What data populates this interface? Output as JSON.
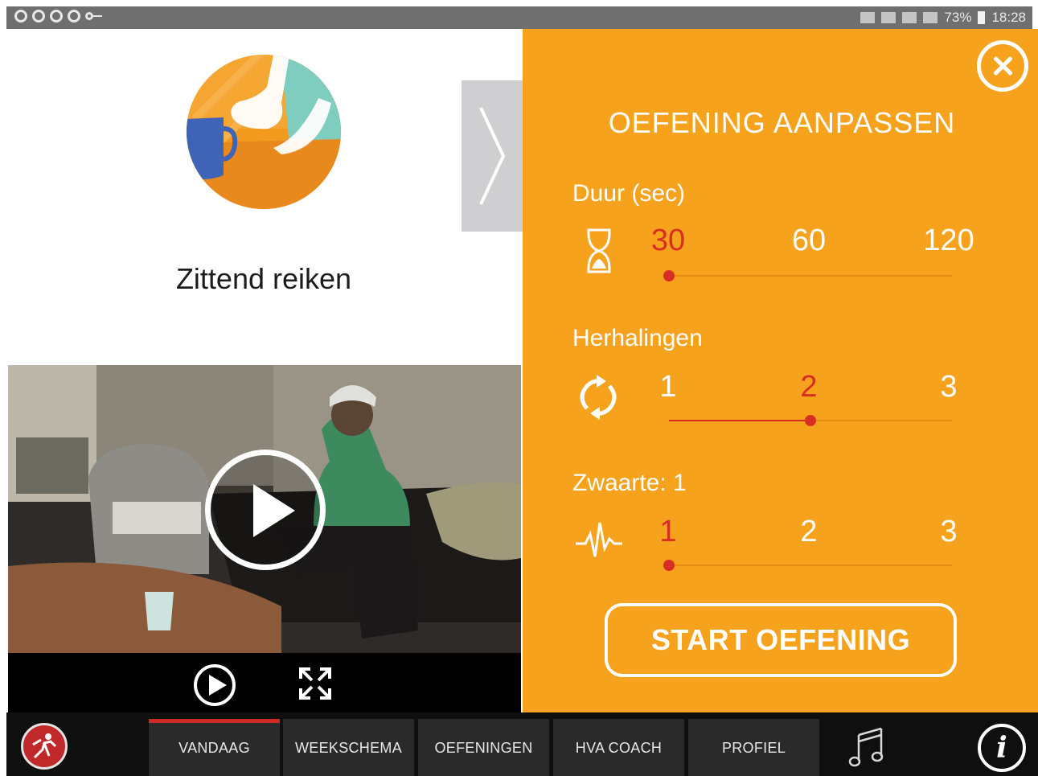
{
  "status_bar": {
    "battery": "73%",
    "time": "18:28"
  },
  "exercise": {
    "title": "Zittend reiken",
    "illustration_icon": "reach-illustration-icon"
  },
  "video": {
    "play_icon": "play-circle-icon",
    "fullscreen_icon": "fullscreen-icon"
  },
  "panel": {
    "title": "OEFENING AANPASSEN",
    "duration": {
      "label": "Duur (sec)",
      "icon": "hourglass-icon",
      "options": [
        "30",
        "60",
        "120"
      ],
      "selected": "30"
    },
    "repetitions": {
      "label": "Herhalingen",
      "icon": "repeat-icon",
      "options": [
        "1",
        "2",
        "3"
      ],
      "selected": "2"
    },
    "intensity": {
      "label": "Zwaarte: 1",
      "icon": "heartbeat-icon",
      "options": [
        "1",
        "2",
        "3"
      ],
      "selected": "1"
    },
    "start_label": "START OEFENING",
    "accent": "#f6a21d",
    "selected_color": "#d82e22"
  },
  "nav": {
    "tabs": [
      "VANDAAG",
      "WEEKSCHEMA",
      "OEFENINGEN",
      "HVA COACH",
      "PROFIEL"
    ],
    "active_tab": "VANDAAG",
    "info_glyph": "i"
  }
}
